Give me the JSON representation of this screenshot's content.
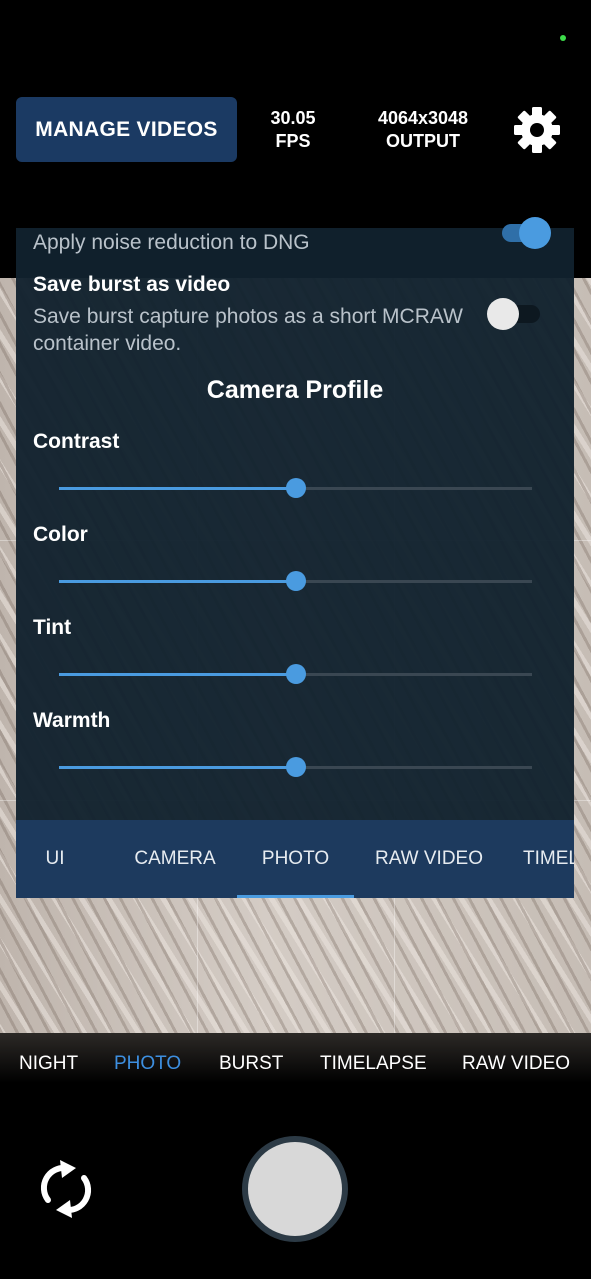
{
  "top_bar": {
    "manage_videos_label": "MANAGE VIDEOS",
    "fps_value": "30.05",
    "fps_unit": "FPS",
    "resolution_value": "4064x3048",
    "resolution_label": "OUTPUT",
    "settings_icon": "gear-icon"
  },
  "panel": {
    "noise_reduction_label": "Apply noise reduction to DNG",
    "noise_reduction_enabled": true,
    "save_burst": {
      "title": "Save burst as video",
      "description": "Save burst capture photos as a short MCRAW container video.",
      "enabled": false
    },
    "section_title": "Camera Profile",
    "sliders": [
      {
        "label": "Contrast",
        "value": 0.5
      },
      {
        "label": "Color",
        "value": 0.5
      },
      {
        "label": "Tint",
        "value": 0.5
      },
      {
        "label": "Warmth",
        "value": 0.5
      }
    ],
    "tabs": [
      {
        "label": "UI"
      },
      {
        "label": "CAMERA"
      },
      {
        "label": "PHOTO",
        "active": true
      },
      {
        "label": "RAW VIDEO"
      },
      {
        "label": "TIMEL"
      }
    ]
  },
  "modes": [
    {
      "label": "NIGHT"
    },
    {
      "label": "PHOTO",
      "active": true
    },
    {
      "label": "BURST"
    },
    {
      "label": "TIMELAPSE"
    },
    {
      "label": "RAW VIDEO"
    }
  ],
  "controls": {
    "switch_camera_icon": "rotate-camera-icon",
    "shutter_icon": "shutter-button"
  },
  "colors": {
    "accent": "#4a9be0",
    "panel_bg": "#11212e",
    "button_bg": "#1b3a63",
    "status_dot": "#3ddc4a"
  }
}
